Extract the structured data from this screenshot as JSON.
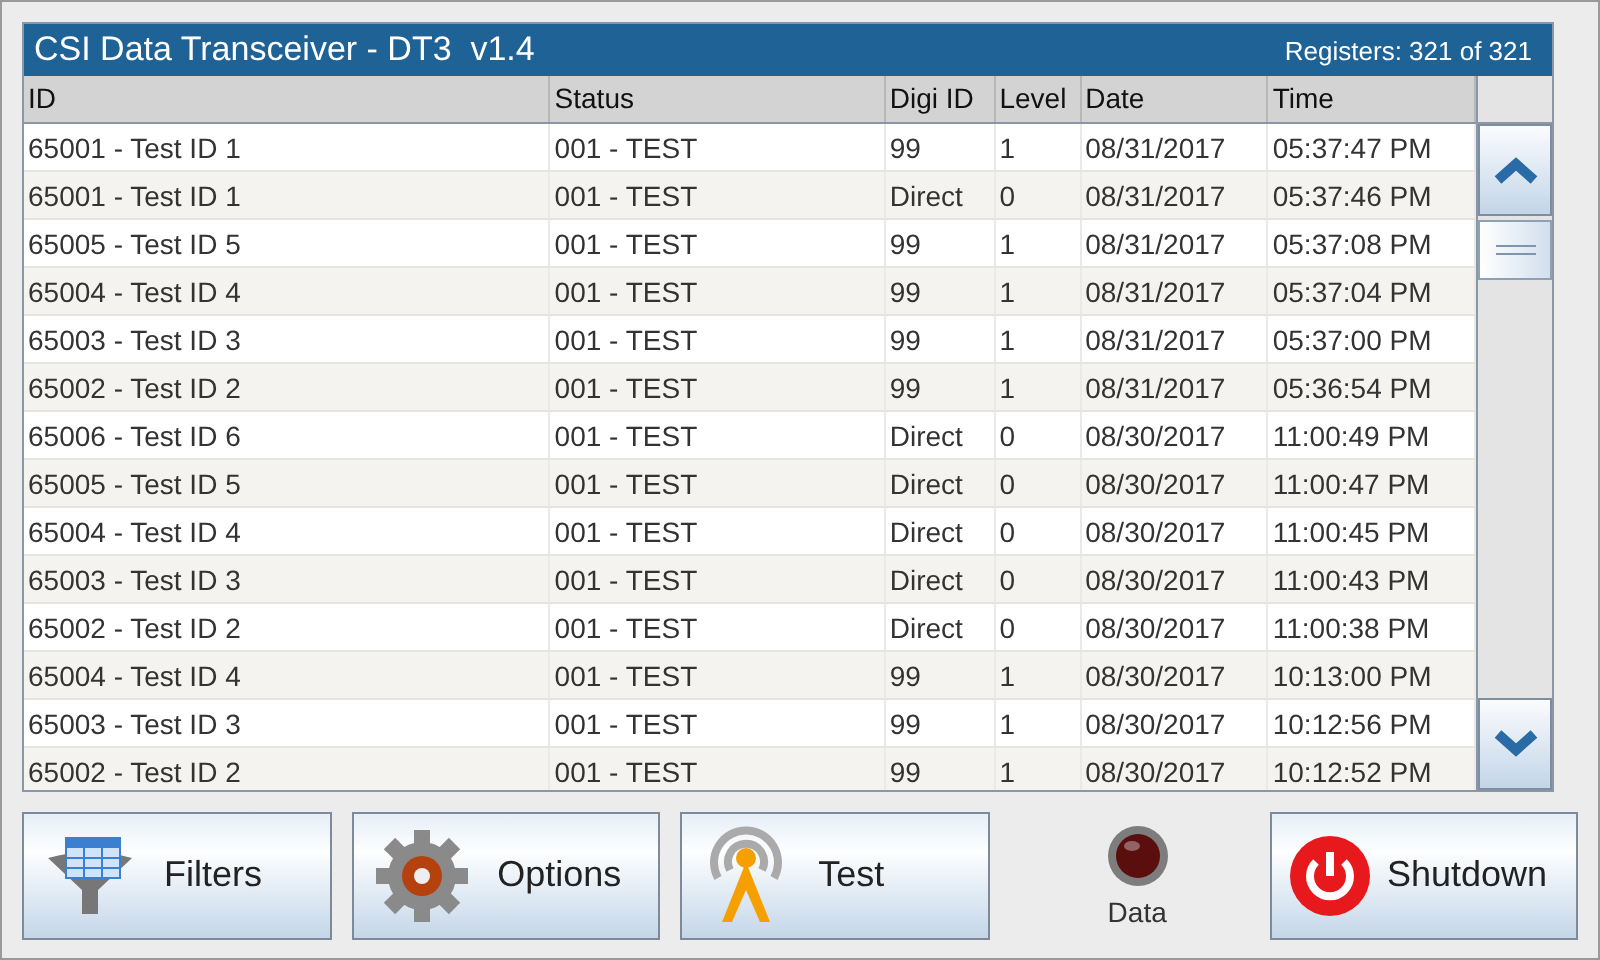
{
  "window": {
    "title": "CSI Data Transceiver - DT3  v1.4",
    "registers": "Registers: 321 of 321"
  },
  "table": {
    "columns": [
      "ID",
      "Status",
      "Digi ID",
      "Level",
      "Date",
      "Time"
    ],
    "rows": [
      [
        "65001 - Test ID 1",
        "001 - TEST",
        "99",
        "1",
        "08/31/2017",
        "05:37:47 PM"
      ],
      [
        "65001 - Test ID 1",
        "001 - TEST",
        "Direct",
        "0",
        "08/31/2017",
        "05:37:46 PM"
      ],
      [
        "65005 - Test ID 5",
        "001 - TEST",
        "99",
        "1",
        "08/31/2017",
        "05:37:08 PM"
      ],
      [
        "65004 - Test ID 4",
        "001 - TEST",
        "99",
        "1",
        "08/31/2017",
        "05:37:04 PM"
      ],
      [
        "65003 - Test ID 3",
        "001 - TEST",
        "99",
        "1",
        "08/31/2017",
        "05:37:00 PM"
      ],
      [
        "65002 - Test ID 2",
        "001 - TEST",
        "99",
        "1",
        "08/31/2017",
        "05:36:54 PM"
      ],
      [
        "65006 - Test ID 6",
        "001 - TEST",
        "Direct",
        "0",
        "08/30/2017",
        "11:00:49 PM"
      ],
      [
        "65005 - Test ID 5",
        "001 - TEST",
        "Direct",
        "0",
        "08/30/2017",
        "11:00:47 PM"
      ],
      [
        "65004 - Test ID 4",
        "001 - TEST",
        "Direct",
        "0",
        "08/30/2017",
        "11:00:45 PM"
      ],
      [
        "65003 - Test ID 3",
        "001 - TEST",
        "Direct",
        "0",
        "08/30/2017",
        "11:00:43 PM"
      ],
      [
        "65002 - Test ID 2",
        "001 - TEST",
        "Direct",
        "0",
        "08/30/2017",
        "11:00:38 PM"
      ],
      [
        "65004 - Test ID 4",
        "001 - TEST",
        "99",
        "1",
        "08/30/2017",
        "10:13:00 PM"
      ],
      [
        "65003 - Test ID 3",
        "001 - TEST",
        "99",
        "1",
        "08/30/2017",
        "10:12:56 PM"
      ],
      [
        "65002 - Test ID 2",
        "001 - TEST",
        "99",
        "1",
        "08/30/2017",
        "10:12:52 PM"
      ]
    ]
  },
  "buttons": [
    {
      "label": "Filters",
      "kind": "filter"
    },
    {
      "label": "Options",
      "kind": "gear"
    },
    {
      "label": "Test",
      "kind": "antenna"
    }
  ],
  "indicator": {
    "label": "Data",
    "on": false
  },
  "shutdown": {
    "label": "Shutdown"
  }
}
